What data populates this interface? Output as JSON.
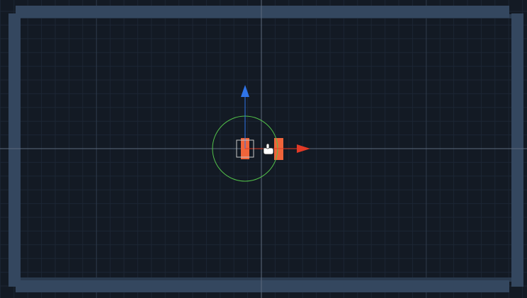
{
  "scene": {
    "background_color": "#131a24",
    "grid": {
      "minor_line_color": "#1c2634",
      "major_line_color": "#2f3b4b",
      "axis_line_color": "#5d6a7c"
    },
    "room_walls": {
      "color": "#34475f",
      "shadow_color": "#2a3a4e",
      "segments": [
        "top",
        "bottom",
        "left",
        "right"
      ]
    },
    "transform_gizmo": {
      "x_axis_color": "#e23a26",
      "y_axis_color": "#2f74e8",
      "rotation_circle_color": "#53c24a",
      "center_handle_color": "#c9c9c9",
      "icons": [
        "move-x-arrow-icon",
        "move-y-arrow-icon",
        "rotate-circle-icon",
        "scale-center-square-icon"
      ]
    },
    "selected_object": {
      "fill_color": "#f0643a",
      "icon": "pointing-hand-cursor-icon"
    }
  }
}
